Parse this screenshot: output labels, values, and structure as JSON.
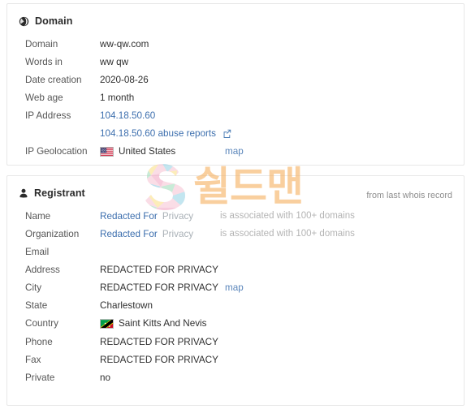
{
  "domain_section": {
    "icon": "globe-icon",
    "title": "Domain",
    "rows": [
      {
        "label": "Domain",
        "value": "ww-qw.com",
        "type": "text"
      },
      {
        "label": "Words in",
        "value": "ww qw",
        "type": "text"
      },
      {
        "label": "Date creation",
        "value": "2020-08-26",
        "type": "text"
      },
      {
        "label": "Web age",
        "value": "1 month",
        "type": "text"
      },
      {
        "label": "IP Address",
        "value": "104.18.50.60",
        "type": "link"
      },
      {
        "label": "",
        "value": "104.18.50.60 abuse reports",
        "type": "link-external"
      },
      {
        "label": "IP Geolocation",
        "value": "United States",
        "type": "flag",
        "flag": "us-flag",
        "map_label": "map"
      }
    ]
  },
  "registrant_section": {
    "icon": "person-icon",
    "title": "Registrant",
    "note": "from last whois record",
    "rows": [
      {
        "label": "Name",
        "value_link": "Redacted For",
        "value_muted": "Privacy",
        "type": "link-muted",
        "aside": "is associated with 100+ domains"
      },
      {
        "label": "Organization",
        "value_link": "Redacted For",
        "value_muted": "Privacy",
        "type": "link-muted",
        "aside": "is associated with 100+ domains"
      },
      {
        "label": "Email",
        "value": "",
        "type": "empty"
      },
      {
        "label": "Address",
        "value": "REDACTED FOR PRIVACY",
        "type": "text"
      },
      {
        "label": "City",
        "value": "REDACTED FOR PRIVACY",
        "type": "text",
        "map_label": "map"
      },
      {
        "label": "State",
        "value": "Charlestown",
        "type": "text"
      },
      {
        "label": "Country",
        "value": "Saint Kitts And Nevis",
        "type": "flag",
        "flag": "kn-flag"
      },
      {
        "label": "Phone",
        "value": "REDACTED FOR PRIVACY",
        "type": "text"
      },
      {
        "label": "Fax",
        "value": "REDACTED FOR PRIVACY",
        "type": "text"
      },
      {
        "label": "Private",
        "value": "no",
        "type": "text"
      }
    ]
  },
  "watermark": {
    "logo_letter": "S",
    "text": "쉴드맨",
    "color": "#f6b263"
  },
  "colors": {
    "link": "#3d6fae",
    "muted": "#a9b0b6",
    "label": "#565656",
    "value": "#2f2f2f",
    "card_border": "#e7e7e7",
    "note": "#8d8d8d"
  }
}
